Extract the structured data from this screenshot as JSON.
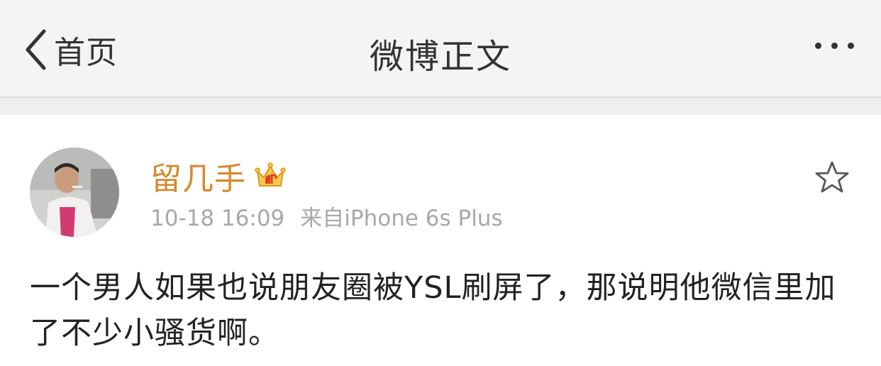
{
  "navbar": {
    "back_label": "首页",
    "title": "微博正文",
    "icons": {
      "back": "chevron-left-icon",
      "more": "more-dots-icon"
    }
  },
  "post": {
    "username": "留几手",
    "badge_icon": "crown-badge-icon",
    "timestamp": "10-18 16:09",
    "source": "来自iPhone 6s Plus",
    "content": "一个男人如果也说朋友圈被YSL刷屏了，那说明他微信里加了不少小骚货啊。",
    "star_icon": "star-outline-icon"
  },
  "colors": {
    "navbar_bg": "#f4f4f4",
    "username": "#d48a2c",
    "meta_text": "#a8a8a8",
    "body_text": "#222222"
  }
}
